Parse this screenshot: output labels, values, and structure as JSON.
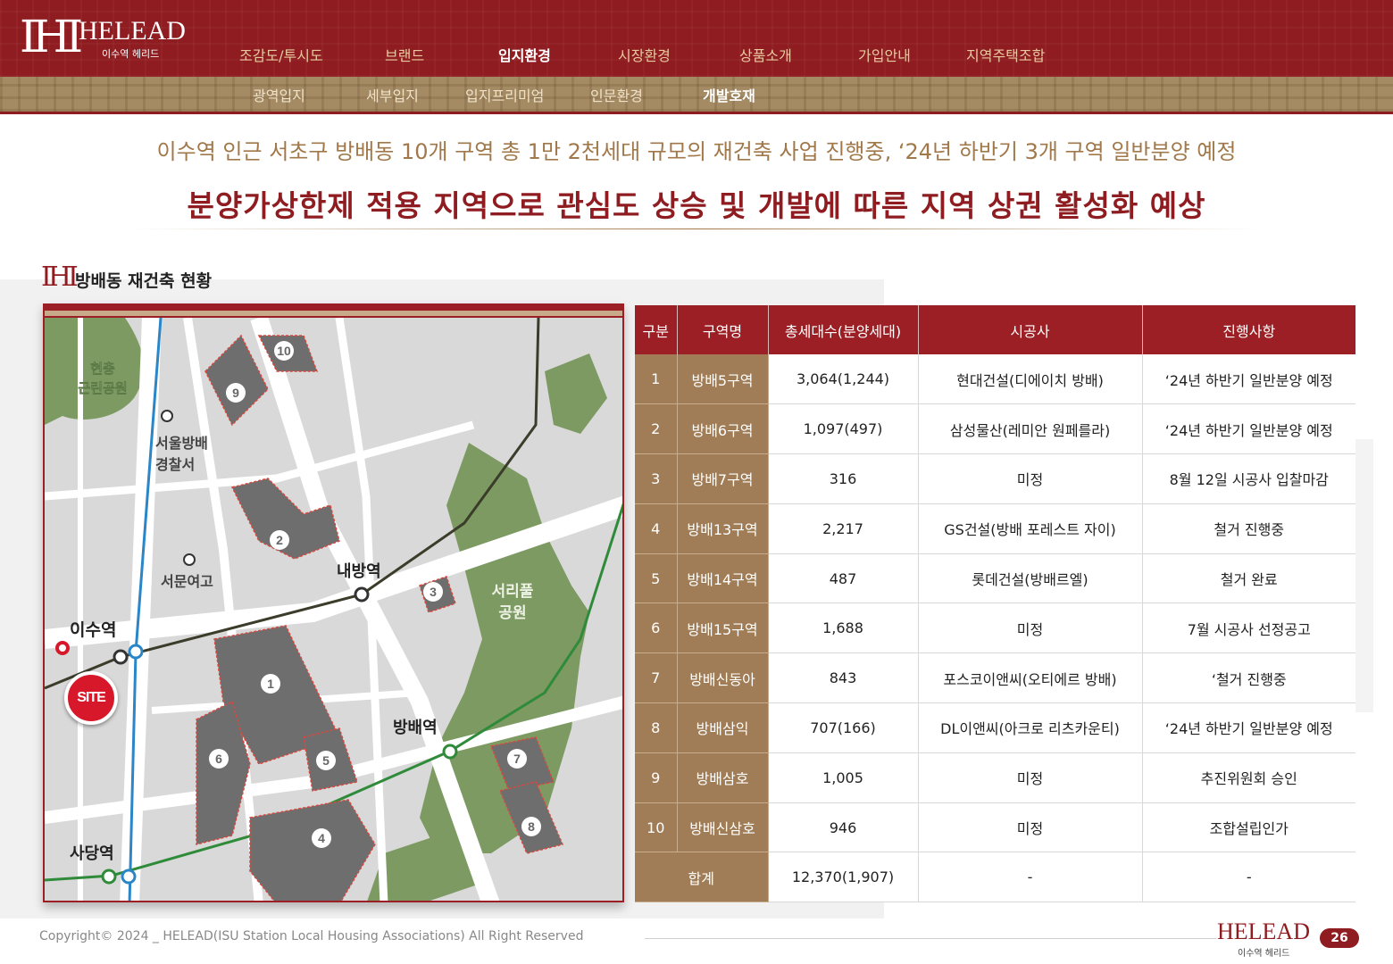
{
  "brand": {
    "mark": "IHI",
    "name": "HELEAD",
    "sub": "이수역 헤리드"
  },
  "nav": [
    "조감도/투시도",
    "브랜드",
    "입지환경",
    "시장환경",
    "상품소개",
    "가입안내",
    "지역주택조합"
  ],
  "nav_active": "입지환경",
  "subnav": [
    "광역입지",
    "세부입지",
    "입지프리미엄",
    "인문환경",
    "개발호재"
  ],
  "subnav_active": "개발호재",
  "headline1": "이수역 인근 서초구 방배동 10개 구역 총 1만 2천세대 규모의 재건축 사업 진행중, ‘24년 하반기 3개 구역 일반분양 예정",
  "headline2": "분양가상한제 적용 지역으로 관심도 상승 및 개발에 따른 지역 상권 활성화 예상",
  "section_title": "방배동 재건축 현황",
  "map": {
    "park_north": [
      "현충",
      "근린공원"
    ],
    "police": [
      "서울방배",
      "경찰서"
    ],
    "school": "서문여고",
    "station_naebang": "내방역",
    "station_isu": "이수역",
    "station_bangbae": "방배역",
    "station_sadang": "사당역",
    "park_east": [
      "서리풀",
      "공원"
    ],
    "site_label": "SITE",
    "zone_numbers": [
      "1",
      "2",
      "3",
      "4",
      "5",
      "6",
      "7",
      "8",
      "9",
      "10"
    ]
  },
  "table": {
    "headers": [
      "구분",
      "구역명",
      "총세대수(분양세대)",
      "시공사",
      "진행사항"
    ],
    "rows": [
      [
        "1",
        "방배5구역",
        "3,064(1,244)",
        "현대건설(디에이치 방배)",
        "‘24년 하반기 일반분양 예정"
      ],
      [
        "2",
        "방배6구역",
        "1,097(497)",
        "삼성물산(레미안 원페를라)",
        "‘24년 하반기 일반분양 예정"
      ],
      [
        "3",
        "방배7구역",
        "316",
        "미정",
        "8월 12일 시공사 입찰마감"
      ],
      [
        "4",
        "방배13구역",
        "2,217",
        "GS건설(방배 포레스트 자이)",
        "철거 진행중"
      ],
      [
        "5",
        "방배14구역",
        "487",
        "롯데건설(방배르엘)",
        "철거 완료"
      ],
      [
        "6",
        "방배15구역",
        "1,688",
        "미정",
        "7월 시공사 선정공고"
      ],
      [
        "7",
        "방배신동아",
        "843",
        "포스코이앤씨(오티에르 방배)",
        "‘철거 진행중"
      ],
      [
        "8",
        "방배삼익",
        "707(166)",
        "DL이앤씨(아크로 리츠카운티)",
        "‘24년 하반기 일반분양 예정"
      ],
      [
        "9",
        "방배삼호",
        "1,005",
        "미정",
        "추진위원회 승인"
      ],
      [
        "10",
        "방배신삼호",
        "946",
        "미정",
        "조합설립인가"
      ]
    ],
    "total": {
      "label": "합계",
      "households": "12,370(1,907)",
      "builder": "-",
      "status": "-"
    }
  },
  "footer": {
    "copyright": "Copyright© 2024 _ HELEAD(ISU Station Local Housing Associations) All Right Reserved",
    "logo": "HELEAD",
    "logo_sub": "이수역 헤리드",
    "page": "26"
  },
  "colors": {
    "primary": "#8e1c20",
    "gold": "#a07d56",
    "accent_text": "#a0784a"
  }
}
